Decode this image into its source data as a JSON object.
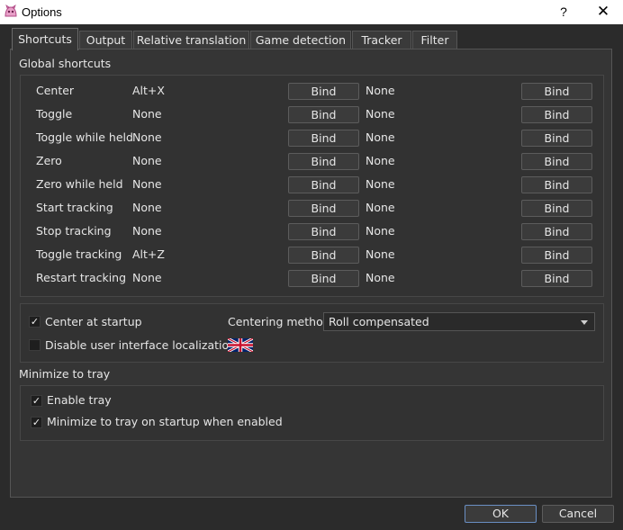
{
  "window": {
    "title": "Options",
    "help_glyph": "?",
    "close_glyph": "✕"
  },
  "tabs": [
    {
      "label": "Shortcuts",
      "active": true
    },
    {
      "label": "Output"
    },
    {
      "label": "Relative translation"
    },
    {
      "label": "Game detection"
    },
    {
      "label": "Tracker"
    },
    {
      "label": "Filter"
    }
  ],
  "global_shortcuts": {
    "heading": "Global shortcuts",
    "bind_label": "Bind",
    "rows": [
      {
        "label": "Center",
        "primary": "Alt+X",
        "secondary": "None"
      },
      {
        "label": "Toggle",
        "primary": "None",
        "secondary": "None"
      },
      {
        "label": "Toggle while held",
        "primary": "None",
        "secondary": "None"
      },
      {
        "label": "Zero",
        "primary": "None",
        "secondary": "None"
      },
      {
        "label": "Zero while held",
        "primary": "None",
        "secondary": "None"
      },
      {
        "label": "Start tracking",
        "primary": "None",
        "secondary": "None"
      },
      {
        "label": "Stop tracking",
        "primary": "None",
        "secondary": "None"
      },
      {
        "label": "Toggle tracking",
        "primary": "Alt+Z",
        "secondary": "None"
      },
      {
        "label": "Restart tracking",
        "primary": "None",
        "secondary": "None"
      }
    ]
  },
  "startup": {
    "center_at_startup": {
      "label": "Center at startup",
      "checked": true
    },
    "disable_localization": {
      "label": "Disable user interface localization",
      "checked": false
    },
    "centering_method_label": "Centering method",
    "centering_method_value": "Roll compensated"
  },
  "tray": {
    "heading": "Minimize to tray",
    "enable_tray": {
      "label": "Enable tray",
      "checked": true
    },
    "minimize_on_startup": {
      "label": "Minimize to tray on startup when enabled",
      "checked": true
    }
  },
  "buttons": {
    "ok": "OK",
    "cancel": "Cancel"
  },
  "icons": {
    "app": "app-logo-icon",
    "flag": "uk-flag-icon",
    "check": "✓"
  }
}
